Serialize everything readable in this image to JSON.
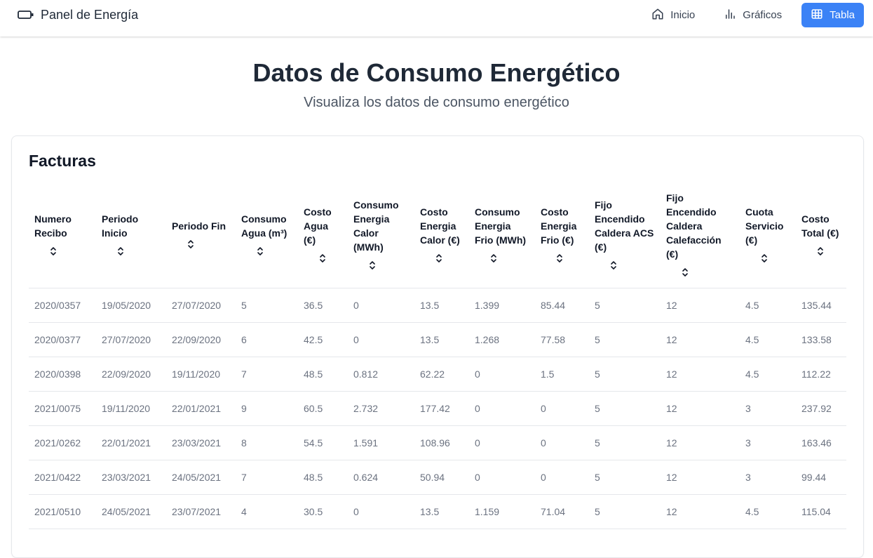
{
  "app": {
    "brand": "Panel de Energía",
    "brand_icon": "battery-icon",
    "accent": "#3b82f6"
  },
  "nav": {
    "items": [
      {
        "label": "Inicio",
        "icon": "home-icon",
        "active": false
      },
      {
        "label": "Gráficos",
        "icon": "bar-chart-icon",
        "active": false
      },
      {
        "label": "Tabla",
        "icon": "table-icon",
        "active": true
      }
    ]
  },
  "page": {
    "title": "Datos de Consumo Energético",
    "subtitle": "Visualiza los datos de consumo energético"
  },
  "card": {
    "title": "Facturas"
  },
  "table": {
    "sort_icon": "sort-icon",
    "columns": [
      "Numero Recibo",
      "Periodo Inicio",
      "Periodo Fin",
      "Consumo Agua (m³)",
      "Costo Agua (€)",
      "Consumo Energia Calor (MWh)",
      "Costo Energia Calor (€)",
      "Consumo Energia Frio (MWh)",
      "Costo Energia Frio (€)",
      "Fijo Encendido Caldera ACS (€)",
      "Fijo Encendido Caldera Calefacción (€)",
      "Cuota Servicio (€)",
      "Costo Total (€)"
    ],
    "rows": [
      [
        "2020/0357",
        "19/05/2020",
        "27/07/2020",
        "5",
        "36.5",
        "0",
        "13.5",
        "1.399",
        "85.44",
        "5",
        "12",
        "4.5",
        "135.44"
      ],
      [
        "2020/0377",
        "27/07/2020",
        "22/09/2020",
        "6",
        "42.5",
        "0",
        "13.5",
        "1.268",
        "77.58",
        "5",
        "12",
        "4.5",
        "133.58"
      ],
      [
        "2020/0398",
        "22/09/2020",
        "19/11/2020",
        "7",
        "48.5",
        "0.812",
        "62.22",
        "0",
        "1.5",
        "5",
        "12",
        "4.5",
        "112.22"
      ],
      [
        "2021/0075",
        "19/11/2020",
        "22/01/2021",
        "9",
        "60.5",
        "2.732",
        "177.42",
        "0",
        "0",
        "5",
        "12",
        "3",
        "237.92"
      ],
      [
        "2021/0262",
        "22/01/2021",
        "23/03/2021",
        "8",
        "54.5",
        "1.591",
        "108.96",
        "0",
        "0",
        "5",
        "12",
        "3",
        "163.46"
      ],
      [
        "2021/0422",
        "23/03/2021",
        "24/05/2021",
        "7",
        "48.5",
        "0.624",
        "50.94",
        "0",
        "0",
        "5",
        "12",
        "3",
        "99.44"
      ],
      [
        "2021/0510",
        "24/05/2021",
        "23/07/2021",
        "4",
        "30.5",
        "0",
        "13.5",
        "1.159",
        "71.04",
        "5",
        "12",
        "4.5",
        "115.04"
      ]
    ]
  }
}
